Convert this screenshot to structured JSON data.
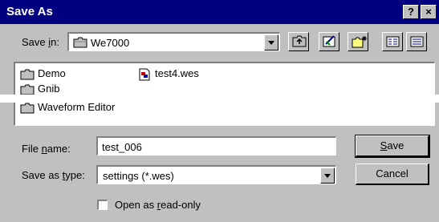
{
  "titlebar": {
    "title": "Save As",
    "help_label": "?",
    "close_label": "×"
  },
  "save_in": {
    "label_pre": "Save ",
    "label_ul": "i",
    "label_post": "n:",
    "value": "We7000"
  },
  "file_list": [
    {
      "name": "Demo",
      "type": "folder"
    },
    {
      "name": "Gnib",
      "type": "folder"
    },
    {
      "name": "Waveform Editor",
      "type": "folder"
    },
    {
      "name": "test4.wes",
      "type": "file"
    }
  ],
  "file_name": {
    "label_pre": "File ",
    "label_ul": "n",
    "label_post": "ame:",
    "value": "test_006"
  },
  "save_type": {
    "label_pre": "Save as ",
    "label_ul": "t",
    "label_post": "ype:",
    "value": "settings (*.wes)"
  },
  "buttons": {
    "save_ul": "S",
    "save_rest": "ave",
    "cancel": "Cancel"
  },
  "readonly": {
    "label_pre": "Open as ",
    "label_ul": "r",
    "label_post": "ead-only",
    "checked": false
  },
  "colors": {
    "titlebar": "#000080",
    "face": "#c0c0c0"
  }
}
